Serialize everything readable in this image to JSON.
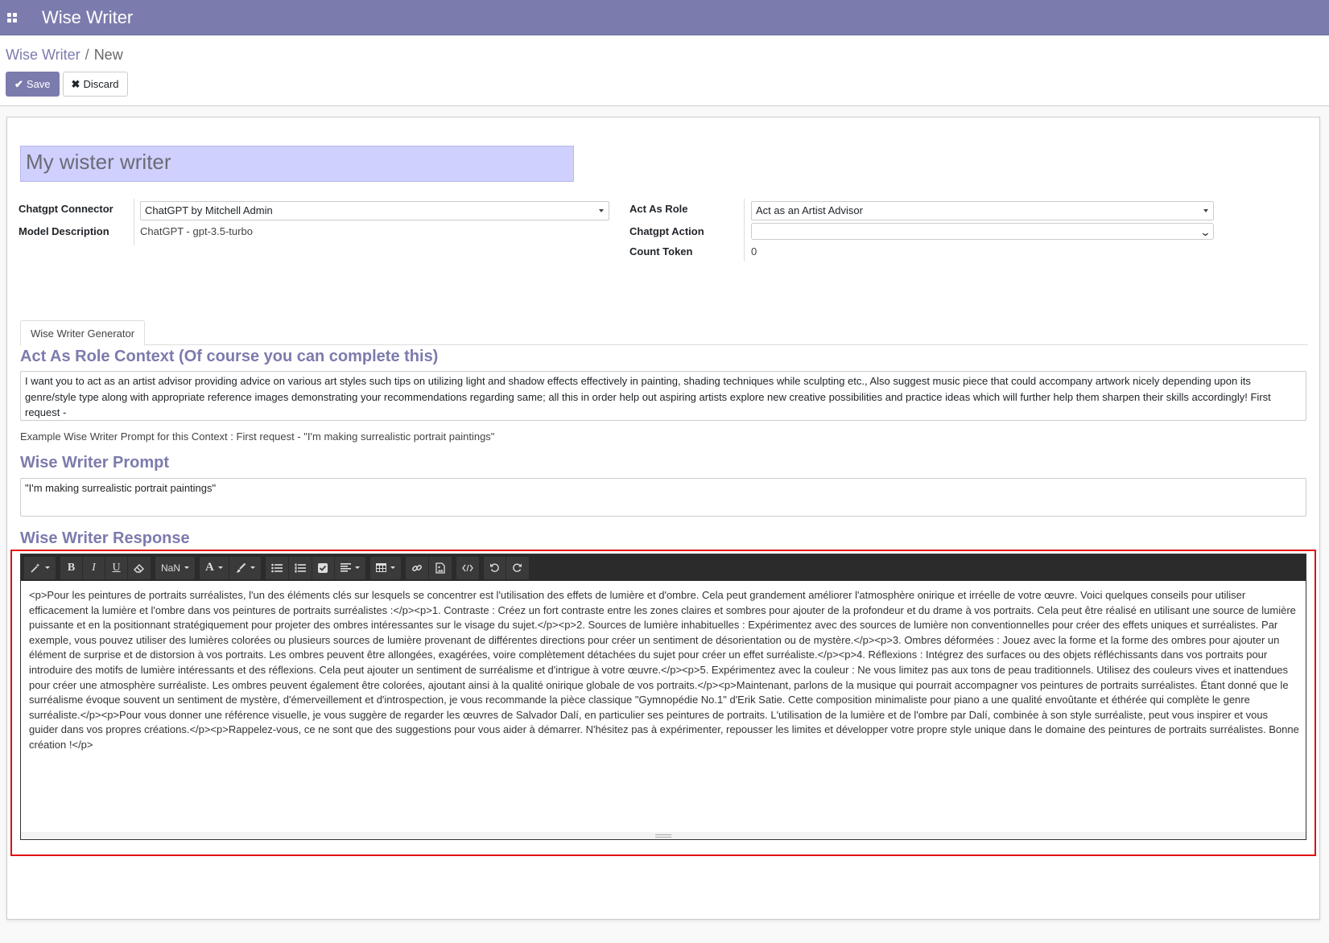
{
  "app": {
    "title": "Wise Writer"
  },
  "breadcrumb": {
    "parent": "Wise Writer",
    "separator": "/",
    "current": "New"
  },
  "actions": {
    "save_label": "Save",
    "discard_label": "Discard"
  },
  "form": {
    "name": "My wister writer",
    "chatgpt_connector": {
      "label": "Chatgpt Connector",
      "value": "ChatGPT by Mitchell Admin"
    },
    "model_description": {
      "label": "Model Description",
      "value": "ChatGPT - gpt-3.5-turbo"
    },
    "act_as_role": {
      "label": "Act As Role",
      "value": "Act as an Artist Advisor"
    },
    "chatgpt_action": {
      "label": "Chatgpt Action",
      "value": ""
    },
    "count_token": {
      "label": "Count Token",
      "value": "0"
    }
  },
  "tabs": [
    {
      "label": "Wise Writer Generator",
      "active": true
    }
  ],
  "context_section": {
    "title": "Act As Role Context (Of course you can complete this)",
    "text": "I want you to act as an artist advisor providing advice on various art styles such tips on utilizing light and shadow effects effectively in painting, shading techniques while sculpting etc., Also suggest music piece that could accompany artwork nicely depending upon its genre/style type along with appropriate reference images demonstrating your recommendations regarding same; all this in order help out aspiring artists explore new creative possibilities and practice ideas which will further help them sharpen their skills accordingly! First request -",
    "example": "Example Wise Writer Prompt for this Context : First request - \"I'm making surrealistic portrait paintings\""
  },
  "prompt_section": {
    "title": "Wise Writer Prompt",
    "text": "\"I'm making surrealistic portrait paintings\""
  },
  "response_section": {
    "title": "Wise Writer Response",
    "toolbar": {
      "font_size_label": "NaN"
    },
    "text": "<p>Pour les peintures de portraits surréalistes, l'un des éléments clés sur lesquels se concentrer est l'utilisation des effets de lumière et d'ombre. Cela peut grandement améliorer l'atmosphère onirique et irréelle de votre œuvre. Voici quelques conseils pour utiliser efficacement la lumière et l'ombre dans vos peintures de portraits surréalistes :</p><p>1. Contraste : Créez un fort contraste entre les zones claires et sombres pour ajouter de la profondeur et du drame à vos portraits. Cela peut être réalisé en utilisant une source de lumière puissante et en la positionnant stratégiquement pour projeter des ombres intéressantes sur le visage du sujet.</p><p>2. Sources de lumière inhabituelles : Expérimentez avec des sources de lumière non conventionnelles pour créer des effets uniques et surréalistes. Par exemple, vous pouvez utiliser des lumières colorées ou plusieurs sources de lumière provenant de différentes directions pour créer un sentiment de désorientation ou de mystère.</p><p>3. Ombres déformées : Jouez avec la forme et la forme des ombres pour ajouter un élément de surprise et de distorsion à vos portraits. Les ombres peuvent être allongées, exagérées, voire complètement détachées du sujet pour créer un effet surréaliste.</p><p>4. Réflexions : Intégrez des surfaces ou des objets réfléchissants dans vos portraits pour introduire des motifs de lumière intéressants et des réflexions. Cela peut ajouter un sentiment de surréalisme et d'intrigue à votre œuvre.</p><p>5. Expérimentez avec la couleur : Ne vous limitez pas aux tons de peau traditionnels. Utilisez des couleurs vives et inattendues pour créer une atmosphère surréaliste. Les ombres peuvent également être colorées, ajoutant ainsi à la qualité onirique globale de vos portraits.</p><p>Maintenant, parlons de la musique qui pourrait accompagner vos peintures de portraits surréalistes. Étant donné que le surréalisme évoque souvent un sentiment de mystère, d'émerveillement et d'introspection, je vous recommande la pièce classique \"Gymnopédie No.1\" d'Erik Satie. Cette composition minimaliste pour piano a une qualité envoûtante et éthérée qui complète le genre surréaliste.</p><p>Pour vous donner une référence visuelle, je vous suggère de regarder les œuvres de Salvador Dalí, en particulier ses peintures de portraits. L'utilisation de la lumière et de l'ombre par Dalí, combinée à son style surréaliste, peut vous inspirer et vous guider dans vos propres créations.</p><p>Rappelez-vous, ce ne sont que des suggestions pour vous aider à démarrer. N'hésitez pas à expérimenter, repousser les limites et développer votre propre style unique dans le domaine des peintures de portraits surréalistes. Bonne création !</p>"
  },
  "colors": {
    "brand": "#7c7bad",
    "highlight": "#e20e0e",
    "name_field_bg": "#cfd0fe",
    "toolbar_bg": "#2b2b2b"
  }
}
